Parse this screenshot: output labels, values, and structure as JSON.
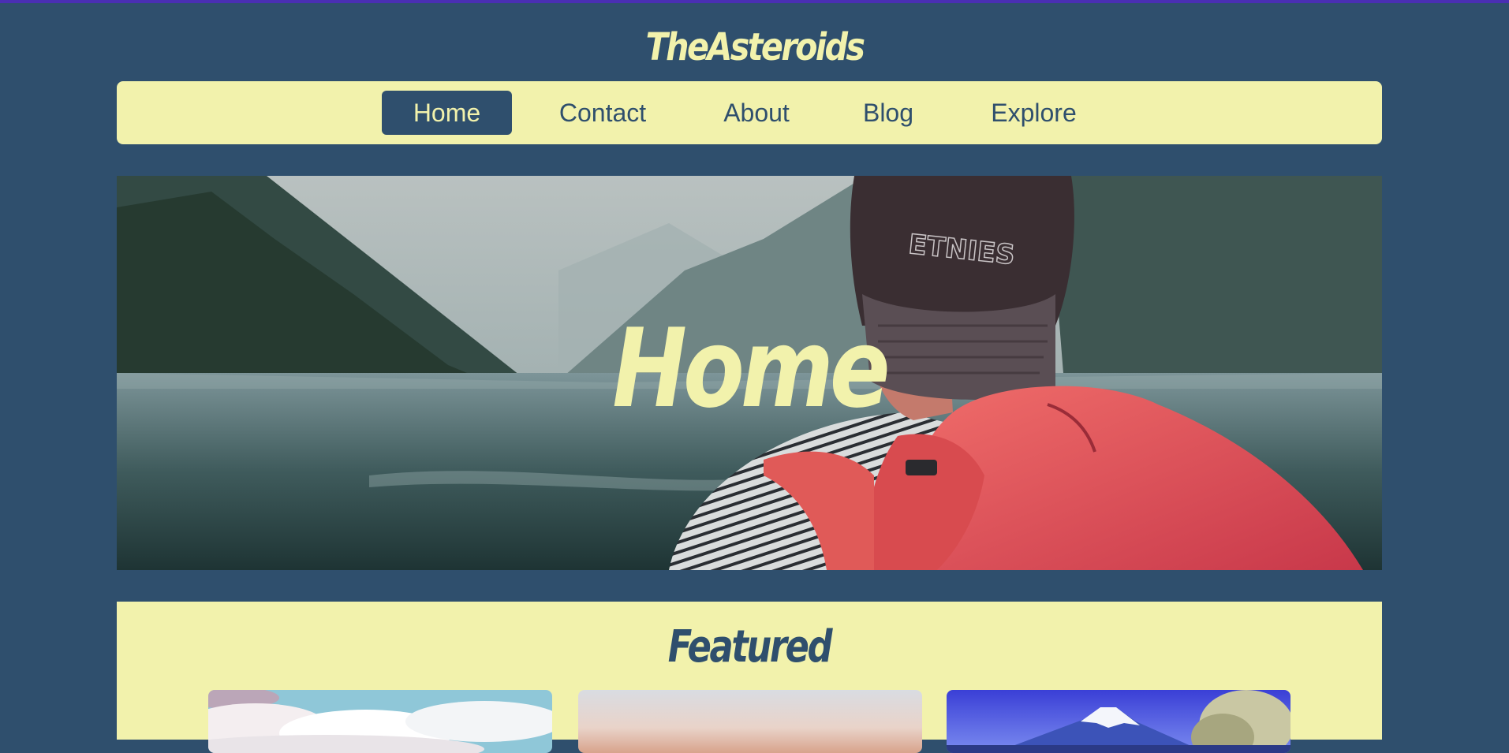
{
  "site": {
    "title": "TheAsteroids"
  },
  "nav": {
    "items": [
      {
        "label": "Home",
        "active": true
      },
      {
        "label": "Contact",
        "active": false
      },
      {
        "label": "About",
        "active": false
      },
      {
        "label": "Blog",
        "active": false
      },
      {
        "label": "Explore",
        "active": false
      }
    ]
  },
  "hero": {
    "title": "Home",
    "cap_text": "ETNIES"
  },
  "featured": {
    "title": "Featured",
    "cards": [
      {
        "image": "clouds-sky-photo"
      },
      {
        "image": "sunset-haze-photo"
      },
      {
        "image": "mount-fuji-photo"
      }
    ]
  },
  "colors": {
    "background": "#2f4f6d",
    "accent": "#f2f2ac",
    "top_border": "#4a2fb3"
  }
}
